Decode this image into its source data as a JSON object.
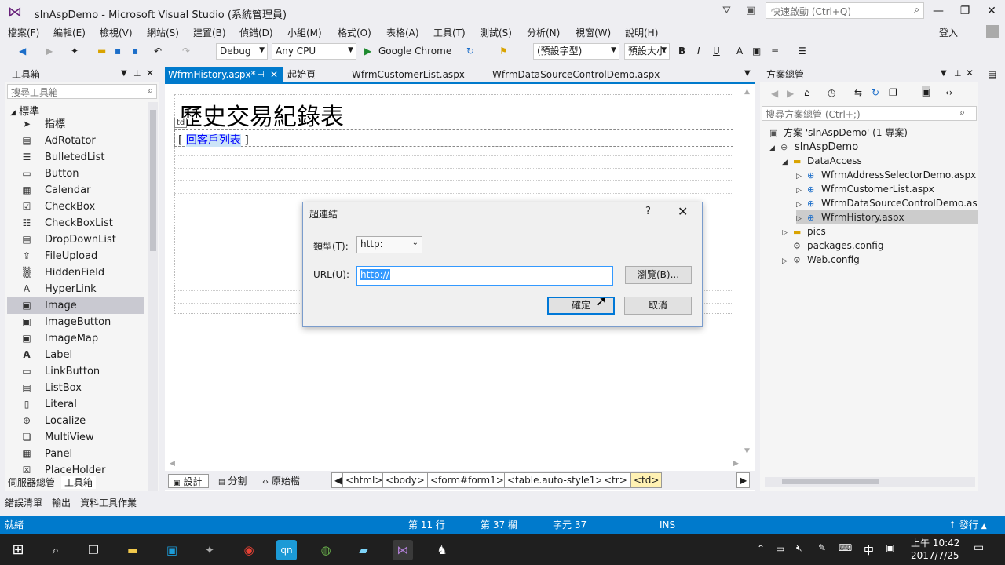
{
  "window": {
    "title": "slnAspDemo - Microsoft Visual Studio (系統管理員)",
    "quick_launch": "快速啟動 (Ctrl+Q)",
    "signin": "登入"
  },
  "menu": [
    "檔案(F)",
    "編輯(E)",
    "檢視(V)",
    "網站(S)",
    "建置(B)",
    "偵錯(D)",
    "小組(M)",
    "格式(O)",
    "表格(A)",
    "工具(T)",
    "測試(S)",
    "分析(N)",
    "視窗(W)",
    "說明(H)"
  ],
  "toolbar": {
    "config": "Debug",
    "platform": "Any CPU",
    "run": "Google Chrome",
    "font": "(預設字型)",
    "size": "預設大小"
  },
  "toolbox": {
    "title": "工具箱",
    "search": "搜尋工具箱",
    "group": "標準",
    "items": [
      "指標",
      "AdRotator",
      "BulletedList",
      "Button",
      "Calendar",
      "CheckBox",
      "CheckBoxList",
      "DropDownList",
      "FileUpload",
      "HiddenField",
      "HyperLink",
      "Image",
      "ImageButton",
      "ImageMap",
      "Label",
      "LinkButton",
      "ListBox",
      "Literal",
      "Localize",
      "MultiView",
      "Panel",
      "PlaceHolder"
    ],
    "selected": "Image"
  },
  "tabs": [
    "WfrmHistory.aspx*",
    "起始頁",
    "WfrmCustomerList.aspx",
    "WfrmDataSourceControlDemo.aspx"
  ],
  "design": {
    "heading": "歷史交易紀錄表",
    "td_tag": "td",
    "link_open": "[",
    "link_text": "回客戶列表",
    "link_close": "]"
  },
  "dialog": {
    "title": "超連結",
    "help": "?",
    "type_label": "類型(T):",
    "type_value": "http:",
    "url_label": "URL(U):",
    "url_value": "http://",
    "browse": "瀏覽(B)...",
    "ok": "確定",
    "cancel": "取消"
  },
  "bottom": {
    "design": "設計",
    "split": "分割",
    "source": "原始檔",
    "crumbs": [
      "<html>",
      "<body>",
      "<form#form1>",
      "<table.auto-style1>",
      "<tr>",
      "<td>"
    ]
  },
  "solution": {
    "title": "方案總管",
    "search": "搜尋方案總管 (Ctrl+;)",
    "nodes": [
      "方案 'slnAspDemo' (1 專案)",
      "slnAspDemo",
      "DataAccess",
      "WfrmAddressSelectorDemo.aspx",
      "WfrmCustomerList.aspx",
      "WfrmDataSourceControlDemo.aspx",
      "WfrmHistory.aspx",
      "pics",
      "packages.config",
      "Web.config"
    ]
  },
  "lowtabs": {
    "server": "伺服器總管",
    "toolbox": "工具箱",
    "errors": "錯誤清單",
    "output": "輸出",
    "tasks": "資料工具作業"
  },
  "status": {
    "ready": "就緒",
    "line": "第 11 行",
    "col": "第 37 欄",
    "ch": "字元 37",
    "ins": "INS",
    "publish": "發行"
  },
  "taskbar": {
    "time": "上午 10:42",
    "date": "2017/7/25",
    "ime": "中"
  }
}
